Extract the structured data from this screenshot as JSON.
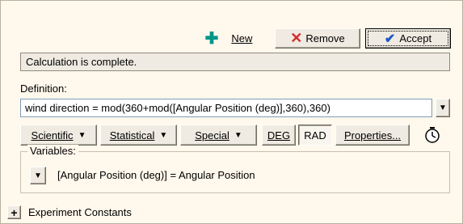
{
  "toolbar": {
    "new_label": "New",
    "remove_label": "Remove",
    "accept_label": "Accept"
  },
  "status": {
    "text": "Calculation is complete."
  },
  "definition": {
    "label": "Definition:",
    "value": "wind direction = mod(360+mod([Angular Position (deg)],360),360)"
  },
  "functions": {
    "scientific": "Scientific",
    "statistical": "Statistical",
    "special": "Special",
    "deg": "DEG",
    "rad": "RAD",
    "properties": "Properties..."
  },
  "variables": {
    "label": "Variables:",
    "items": [
      {
        "text": "[Angular Position (deg)] = Angular Position"
      }
    ]
  },
  "experiment_constants": {
    "label": "Experiment Constants"
  },
  "colors": {
    "panel_bg": "#fff8ec",
    "plus_green": "#009688",
    "remove_red": "#d62c2c",
    "accept_check": "#1a56c8"
  },
  "icons": [
    "plus-icon",
    "x-icon",
    "checkmark-icon",
    "dropdown-arrow-icon",
    "timer-icon",
    "expand-plus-icon"
  ]
}
